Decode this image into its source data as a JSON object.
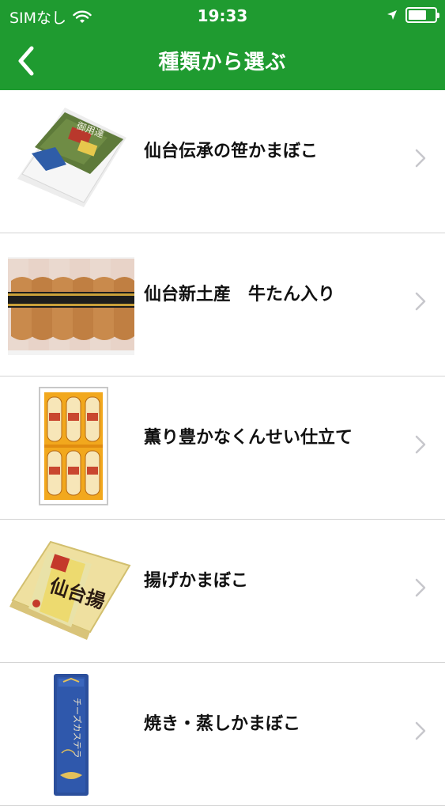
{
  "status": {
    "carrier": "SIMなし",
    "time": "19:33",
    "battery_level": 0.7
  },
  "nav": {
    "title": "種類から選ぶ",
    "back_icon": "chevron-left-icon"
  },
  "colors": {
    "header": "#1f9b30",
    "divider": "#d4d4d4",
    "chevron": "#c7c7cc"
  },
  "categories": [
    {
      "label": "仙台伝承の笹かまぼこ"
    },
    {
      "label": "仙台新土産　牛たん入り"
    },
    {
      "label": "薫り豊かなくんせい仕立て"
    },
    {
      "label": "揚げかまぼこ"
    },
    {
      "label": "焼き・蒸しかまぼこ"
    }
  ],
  "product_images": {
    "box_0": {
      "title_text": "御用達"
    },
    "box_3": {
      "title_text": "仙台揚"
    },
    "box_4": {
      "title_text": "チーズカステラ"
    }
  }
}
